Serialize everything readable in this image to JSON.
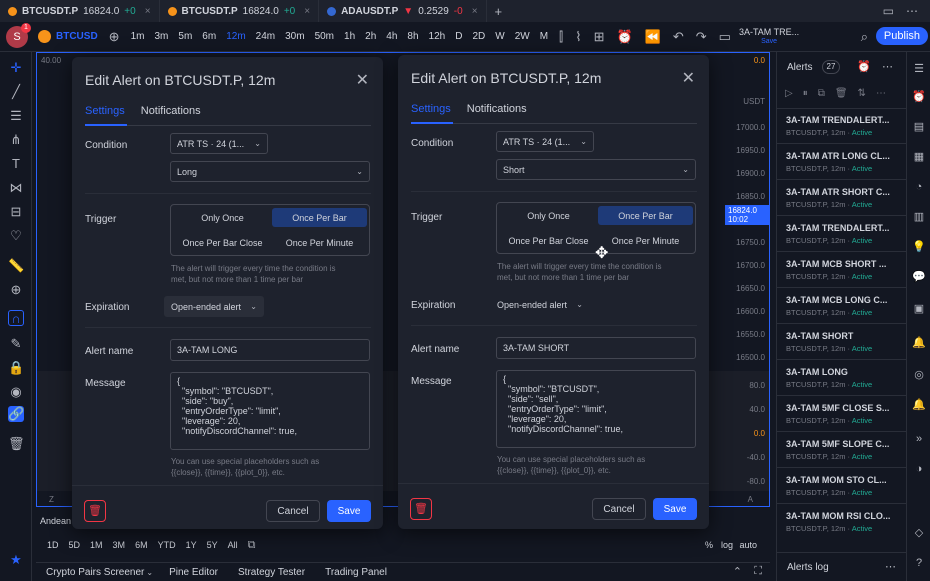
{
  "tabs": [
    {
      "symbol": "BTCUSDT.P",
      "price": "16824.0",
      "change": "+0",
      "close": "×"
    },
    {
      "symbol": "BTCUSDT.P",
      "price": "16824.0",
      "change": "+0",
      "close": "×"
    },
    {
      "symbol": "ADAUSDT.P",
      "price": "0.2529",
      "change": "-0",
      "close": "×"
    }
  ],
  "new_tab": "+",
  "toolbar": {
    "avatar_letter": "S",
    "notif": "1",
    "symbol": "BTCUSD",
    "intervals": [
      "1m",
      "3m",
      "5m",
      "6m",
      "12m",
      "24m",
      "30m",
      "50m",
      "1h",
      "2h",
      "4h",
      "8h",
      "12h",
      "D",
      "2D",
      "W",
      "2W",
      "M"
    ],
    "active_interval": "12m",
    "layout_name": "3A-TAM TRE...",
    "layout_sub": "Save",
    "publish": "Publish"
  },
  "chart": {
    "prices": [
      "17000.0",
      "16950.0",
      "16900.0",
      "16850.0",
      "16800.0",
      "16750.0",
      "16700.0",
      "16650.0",
      "16600.0",
      "16550.0",
      "16500.0"
    ],
    "current_price": "16824.0",
    "countdown": "10:02",
    "currency": "USDT",
    "lower_prices": [
      "80.0",
      "40.0",
      "0.0",
      "-40.0",
      "-80.0"
    ],
    "top_left_value": "40.00",
    "top_value": "0.0",
    "indicator_label": "Andean"
  },
  "range_bar": [
    "1D",
    "5D",
    "1M",
    "3M",
    "6M",
    "YTD",
    "1Y",
    "5Y",
    "All"
  ],
  "scale_opts": [
    "%",
    "log",
    "auto"
  ],
  "bottom_tabs": [
    "Crypto Pairs Screener",
    "Pine Editor",
    "Strategy Tester",
    "Trading Panel"
  ],
  "dialog_left": {
    "title": "Edit Alert on BTCUSDT.P, 12m",
    "tab_settings": "Settings",
    "tab_notifications": "Notifications",
    "condition_label": "Condition",
    "condition_value": "ATR TS · 24 (1...",
    "direction": "Long",
    "trigger_label": "Trigger",
    "trigger_opts": [
      "Only Once",
      "Once Per Bar",
      "Once Per Bar Close",
      "Once Per Minute"
    ],
    "trigger_active": "Once Per Bar",
    "trigger_hint_1": "The alert will trigger every time the condition is",
    "trigger_hint_2": "met, but not more than 1 time per bar",
    "expiration_label": "Expiration",
    "expiration_value": "Open-ended alert",
    "alert_name_label": "Alert name",
    "alert_name": "3A-TAM LONG",
    "message_label": "Message",
    "message": "{\n  \"symbol\": \"BTCUSDT\",\n  \"side\": \"buy\",\n  \"entryOrderType\": \"limit\",\n  \"leverage\": 20,\n  \"notifyDiscordChannel\": true,",
    "placeholder_hint_1": "You can use special placeholders such as",
    "placeholder_hint_2": "{{close}}, {{time}}, {{plot_0}}, etc.",
    "cancel": "Cancel",
    "save": "Save"
  },
  "dialog_right": {
    "title": "Edit Alert on BTCUSDT.P, 12m",
    "tab_settings": "Settings",
    "tab_notifications": "Notifications",
    "condition_label": "Condition",
    "condition_value": "ATR TS · 24 (1...",
    "direction": "Short",
    "trigger_label": "Trigger",
    "trigger_opts": [
      "Only Once",
      "Once Per Bar",
      "Once Per Bar Close",
      "Once Per Minute"
    ],
    "trigger_active": "Once Per Bar",
    "trigger_hint_1": "The alert will trigger every time the condition is",
    "trigger_hint_2": "met, but not more than 1 time per bar",
    "expiration_label": "Expiration",
    "expiration_value": "Open-ended alert",
    "alert_name_label": "Alert name",
    "alert_name": "3A-TAM SHORT",
    "message_label": "Message",
    "message": "{\n  \"symbol\": \"BTCUSDT\",\n  \"side\": \"sell\",\n  \"entryOrderType\": \"limit\",\n  \"leverage\": 20,\n  \"notifyDiscordChannel\": true,",
    "placeholder_hint_1": "You can use special placeholders such as",
    "placeholder_hint_2": "{{close}}, {{time}}, {{plot_0}}, etc.",
    "cancel": "Cancel",
    "save": "Save"
  },
  "alerts_panel": {
    "title": "Alerts",
    "count": "27",
    "log": "Alerts log",
    "items": [
      {
        "name": "3A-TAM TRENDALERT...",
        "sub": "BTCUSDT.P, 12m",
        "status": "Active"
      },
      {
        "name": "3A-TAM ATR LONG CL...",
        "sub": "BTCUSDT.P, 12m",
        "status": "Active"
      },
      {
        "name": "3A-TAM ATR SHORT C...",
        "sub": "BTCUSDT.P, 12m",
        "status": "Active"
      },
      {
        "name": "3A-TAM TRENDALERT...",
        "sub": "BTCUSDT.P, 12m",
        "status": "Active"
      },
      {
        "name": "3A-TAM MCB SHORT ...",
        "sub": "BTCUSDT.P, 12m",
        "status": "Active"
      },
      {
        "name": "3A-TAM MCB LONG C...",
        "sub": "BTCUSDT.P, 12m",
        "status": "Active"
      },
      {
        "name": "3A-TAM SHORT",
        "sub": "BTCUSDT.P, 12m",
        "status": "Active"
      },
      {
        "name": "3A-TAM LONG",
        "sub": "BTCUSDT.P, 12m",
        "status": "Active"
      },
      {
        "name": "3A-TAM 5MF CLOSE S...",
        "sub": "BTCUSDT.P, 12m",
        "status": "Active"
      },
      {
        "name": "3A-TAM 5MF SLOPE C...",
        "sub": "BTCUSDT.P, 12m",
        "status": "Active"
      },
      {
        "name": "3A-TAM MOM STO CL...",
        "sub": "BTCUSDT.P, 12m",
        "status": "Active"
      },
      {
        "name": "3A-TAM MOM RSI CLO...",
        "sub": "BTCUSDT.P, 12m",
        "status": "Active"
      }
    ]
  },
  "accent": "#2962ff"
}
